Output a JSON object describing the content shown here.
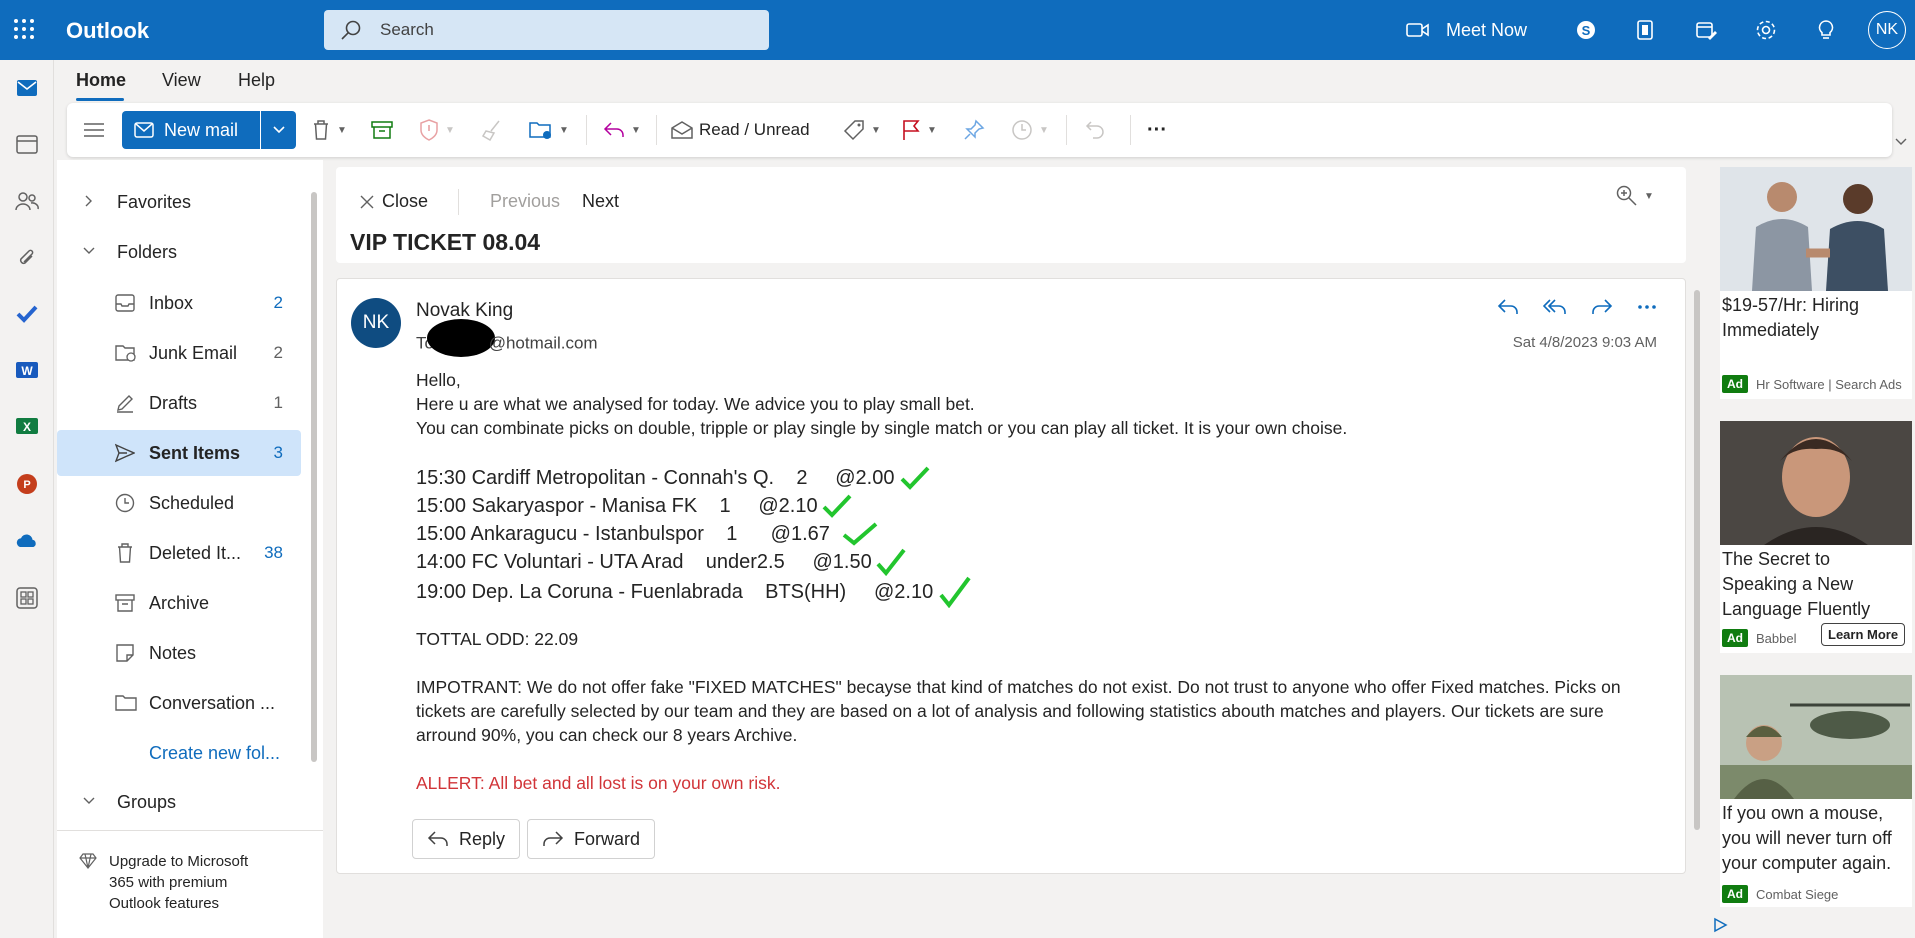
{
  "app": {
    "name": "Outlook",
    "user_initials": "NK"
  },
  "search": {
    "placeholder": "Search"
  },
  "topbar": {
    "meet_now": "Meet Now"
  },
  "tabs": [
    {
      "label": "Home"
    },
    {
      "label": "View"
    },
    {
      "label": "Help"
    }
  ],
  "ribbon": {
    "new_mail": "New mail",
    "read_unread": "Read / Unread",
    "more": "···"
  },
  "folders": {
    "favorites": "Favorites",
    "folders_label": "Folders",
    "items": [
      {
        "label": "Inbox",
        "count": "2"
      },
      {
        "label": "Junk Email",
        "count": "2"
      },
      {
        "label": "Drafts",
        "count": "1"
      },
      {
        "label": "Sent Items",
        "count": "3"
      },
      {
        "label": "Scheduled",
        "count": ""
      },
      {
        "label": "Deleted It...",
        "count": "38"
      },
      {
        "label": "Archive",
        "count": ""
      },
      {
        "label": "Notes",
        "count": ""
      },
      {
        "label": "Conversation ...",
        "count": ""
      }
    ],
    "create_new": "Create new fol...",
    "groups": "Groups",
    "upgrade": [
      "Upgrade to Microsoft",
      "365 with premium",
      "Outlook features"
    ]
  },
  "reading": {
    "close": "Close",
    "previous": "Previous",
    "next": "Next",
    "subject": "VIP TICKET 08.04"
  },
  "message": {
    "sender_initials": "NK",
    "sender": "Novak King",
    "to_prefix": "To:",
    "to_visible": "@hotmail.com",
    "date": "Sat 4/8/2023 9:03 AM",
    "greeting": "Hello,",
    "line1": "Here u are what we analysed for today. We advice you to play small bet.",
    "line2": "You can combinate picks on double, tripple or play single by single match or you can play all ticket. It is your own choise.",
    "picks": [
      "15:30 Cardiff Metropolitan - Connah's Q.    2     @2.00",
      "15:00 Sakaryaspor - Manisa FK    1     @2.10",
      "15:00 Ankaragucu - Istanbulspor    1      @1.67",
      "14:00 FC Voluntari - UTA Arad    under2.5     @1.50",
      "19:00 Dep. La Coruna - Fuenlabrada    BTS(HH)     @2.10"
    ],
    "total": "TOTTAL ODD: 22.09",
    "important": "IMPOTRANT: We do not offer fake \"FIXED MATCHES\" becayse that kind of matches do not exist. Do not trust to anyone who offer Fixed matches. Picks on tickets are carefully selected by our team and they are based on a lot of analysis and following statistics abouth matches and players. Our tickets are sure arround 90%, you can check our 8 years Archive.",
    "alert": "ALLERT: All bet and all lost is on your own risk.",
    "reply": "Reply",
    "forward": "Forward",
    "alert_color": "#d13438",
    "check_color": "#22c52e"
  },
  "ads": [
    {
      "title": "$19-57/Hr: Hiring Immediately",
      "badge": "Ad",
      "source": "Hr Software | Search Ads"
    },
    {
      "title": "The Secret to Speaking a New Language Fluently",
      "badge": "Ad",
      "source": "Babbel",
      "cta": "Learn More"
    },
    {
      "title": "If you own a mouse, you will never turn off your computer again.",
      "badge": "Ad",
      "source": "Combat Siege"
    }
  ],
  "colors": {
    "brand": "#0f6cbd",
    "selected": "#cfe4fa"
  }
}
